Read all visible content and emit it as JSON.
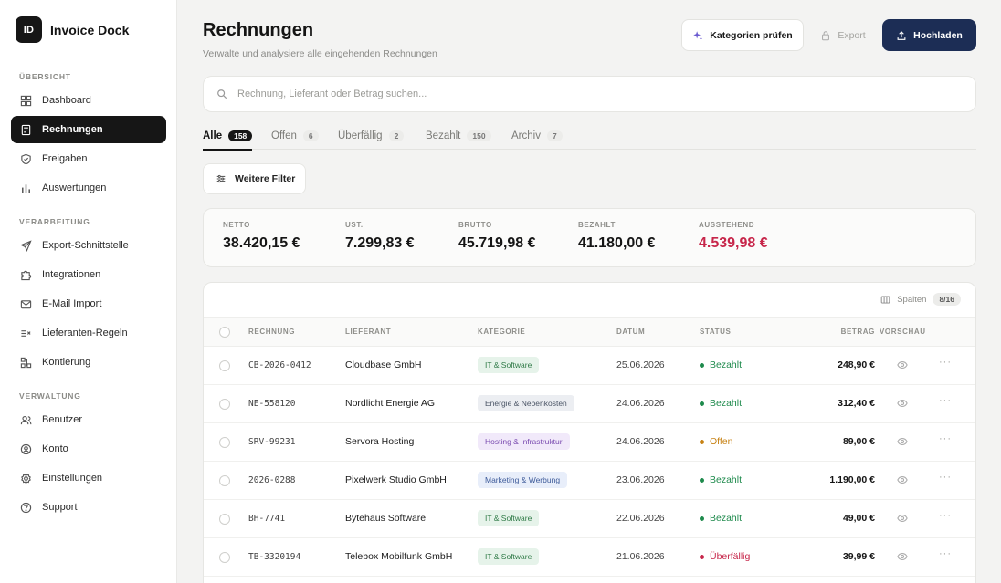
{
  "app": {
    "logo": "ID",
    "name": "Invoice Dock"
  },
  "sidebar": {
    "sections": [
      {
        "label": "ÜBERSICHT",
        "items": [
          {
            "label": "Dashboard",
            "icon": "grid-icon"
          },
          {
            "label": "Rechnungen",
            "icon": "receipt-icon",
            "active": true
          },
          {
            "label": "Freigaben",
            "icon": "shield-check-icon"
          },
          {
            "label": "Auswertungen",
            "icon": "bar-chart-icon"
          }
        ]
      },
      {
        "label": "VERARBEITUNG",
        "items": [
          {
            "label": "Export-Schnittstelle",
            "icon": "send-icon"
          },
          {
            "label": "Integrationen",
            "icon": "puzzle-icon"
          },
          {
            "label": "E-Mail Import",
            "icon": "mail-icon"
          },
          {
            "label": "Lieferanten-Regeln",
            "icon": "rules-icon"
          },
          {
            "label": "Kontierung",
            "icon": "flow-icon"
          }
        ]
      },
      {
        "label": "VERWALTUNG",
        "items": [
          {
            "label": "Benutzer",
            "icon": "users-icon"
          },
          {
            "label": "Konto",
            "icon": "user-circle-icon"
          },
          {
            "label": "Einstellungen",
            "icon": "gear-icon"
          },
          {
            "label": "Support",
            "icon": "help-icon"
          }
        ]
      }
    ]
  },
  "header": {
    "title": "Rechnungen",
    "subtitle": "Verwalte und analysiere alle eingehenden Rechnungen",
    "categories_label": "Kategorien prüfen",
    "export_label": "Export",
    "upload_label": "Hochladen"
  },
  "search": {
    "placeholder": "Rechnung, Lieferant oder Betrag suchen..."
  },
  "tabs": [
    {
      "label": "Alle",
      "count": "158",
      "active": true
    },
    {
      "label": "Offen",
      "count": "6"
    },
    {
      "label": "Überfällig",
      "count": "2"
    },
    {
      "label": "Bezahlt",
      "count": "150"
    },
    {
      "label": "Archiv",
      "count": "7"
    }
  ],
  "filter": {
    "label": "Weitere Filter"
  },
  "kpis": [
    {
      "label": "NETTO",
      "value": "38.420,15 €"
    },
    {
      "label": "UST.",
      "value": "7.299,83 €"
    },
    {
      "label": "BRUTTO",
      "value": "45.719,98 €"
    },
    {
      "label": "BEZAHLT",
      "value": "41.180,00 €"
    },
    {
      "label": "AUSSTEHEND",
      "value": "4.539,98 €",
      "highlight": true
    }
  ],
  "table": {
    "columns_label": "Spalten",
    "columns_count": "8/16",
    "headers": {
      "invoice": "RECHNUNG",
      "supplier": "LIEFERANT",
      "category": "KATEGORIE",
      "date": "DATUM",
      "status": "STATUS",
      "amount": "BETRAG",
      "preview": "VORSCHAU"
    },
    "rows": [
      {
        "invoice": "CB-2026-0412",
        "supplier": "Cloudbase GmbH",
        "category": "IT & Software",
        "cat_type": "it",
        "date": "25.06.2026",
        "status": "Bezahlt",
        "status_type": "paid",
        "amount": "248,90 €"
      },
      {
        "invoice": "NE-558120",
        "supplier": "Nordlicht Energie AG",
        "category": "Energie & Nebenkosten",
        "cat_type": "energy",
        "date": "24.06.2026",
        "status": "Bezahlt",
        "status_type": "paid",
        "amount": "312,40 €"
      },
      {
        "invoice": "SRV-99231",
        "supplier": "Servora Hosting",
        "category": "Hosting & Infrastruktur",
        "cat_type": "hosting",
        "date": "24.06.2026",
        "status": "Offen",
        "status_type": "open",
        "amount": "89,00 €"
      },
      {
        "invoice": "2026-0288",
        "supplier": "Pixelwerk Studio GmbH",
        "category": "Marketing & Werbung",
        "cat_type": "marketing",
        "date": "23.06.2026",
        "status": "Bezahlt",
        "status_type": "paid",
        "amount": "1.190,00 €"
      },
      {
        "invoice": "BH-7741",
        "supplier": "Bytehaus Software",
        "category": "IT & Software",
        "cat_type": "it",
        "date": "22.06.2026",
        "status": "Bezahlt",
        "status_type": "paid",
        "amount": "49,00 €"
      },
      {
        "invoice": "TB-3320194",
        "supplier": "Telebox Mobilfunk GmbH",
        "category": "IT & Software",
        "cat_type": "it",
        "date": "21.06.2026",
        "status": "Überfällig",
        "status_type": "overdue",
        "amount": "39,99 €"
      }
    ]
  },
  "colors": {
    "primary": "#1c2d55",
    "paid": "#1e8a4c",
    "open": "#c78214",
    "overdue": "#c7264a",
    "tag_it": "#e6f3ea",
    "tag_it_text": "#2f7a47",
    "tag_energy": "#eceef2",
    "tag_energy_text": "#4b5566",
    "tag_hosting": "#f1e9fa",
    "tag_hosting_text": "#7a4bb0",
    "tag_marketing": "#e8eefa",
    "tag_marketing_text": "#3d5a99"
  }
}
